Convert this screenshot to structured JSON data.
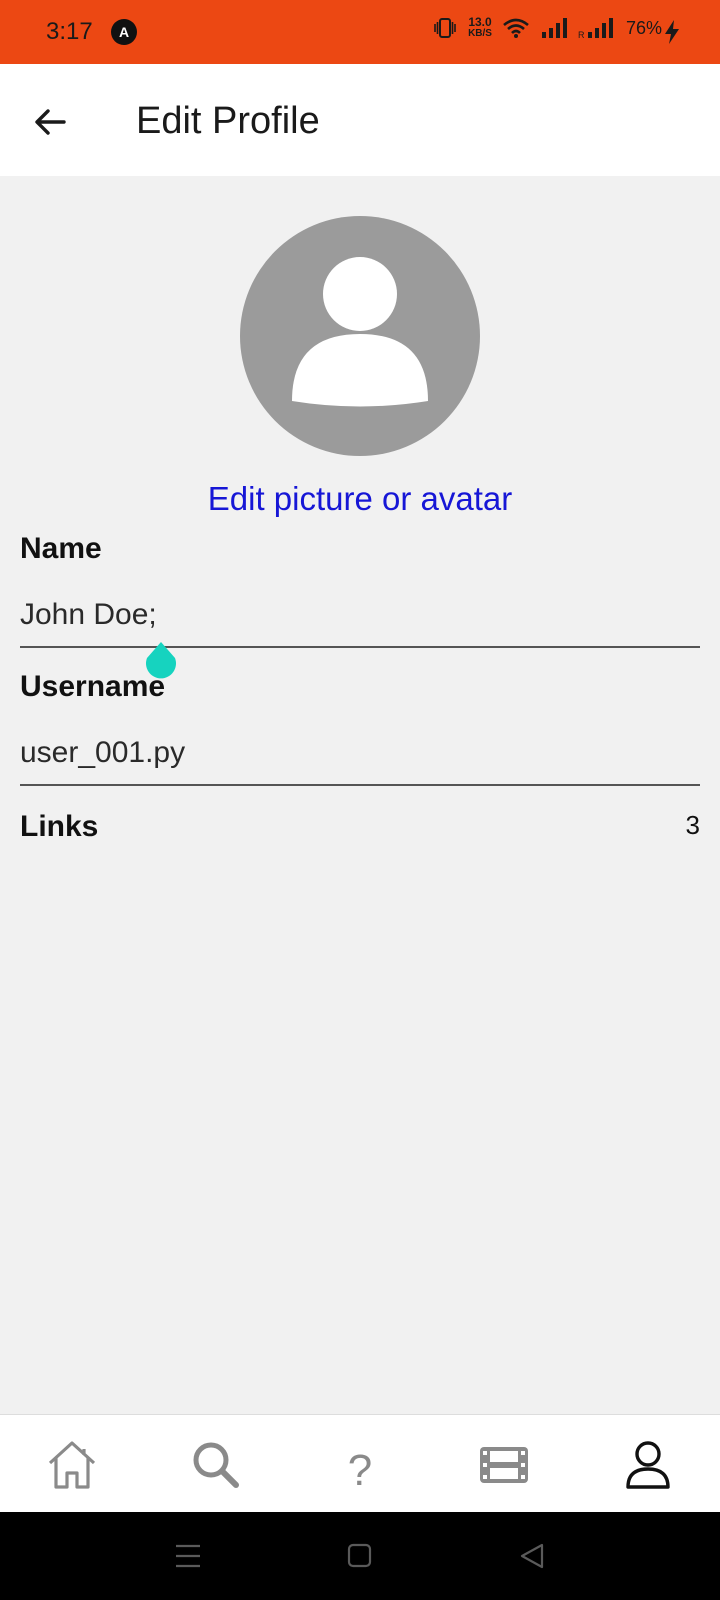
{
  "status_bar": {
    "time": "3:17",
    "speed_value": "13.0",
    "speed_unit": "KB/S",
    "battery": "76%",
    "color": "#ec4813"
  },
  "app_bar": {
    "title": "Edit Profile",
    "back_icon": "arrow-back-icon"
  },
  "profile": {
    "avatar_icon": "person-placeholder-icon",
    "edit_link": "Edit picture or avatar",
    "link_color": "#1616d6"
  },
  "form": {
    "name_label": "Name",
    "name_value": "John Doe;",
    "username_label": "Username",
    "username_value": "user_001.py",
    "links_label": "Links",
    "links_count": "3"
  },
  "bottom_nav": {
    "items": [
      {
        "icon": "home-icon"
      },
      {
        "icon": "search-icon"
      },
      {
        "icon": "help-icon"
      },
      {
        "icon": "film-icon"
      },
      {
        "icon": "profile-icon",
        "active": true
      }
    ]
  },
  "system_nav": {
    "items": [
      "menu-icon",
      "home-square-icon",
      "back-triangle-icon"
    ]
  }
}
